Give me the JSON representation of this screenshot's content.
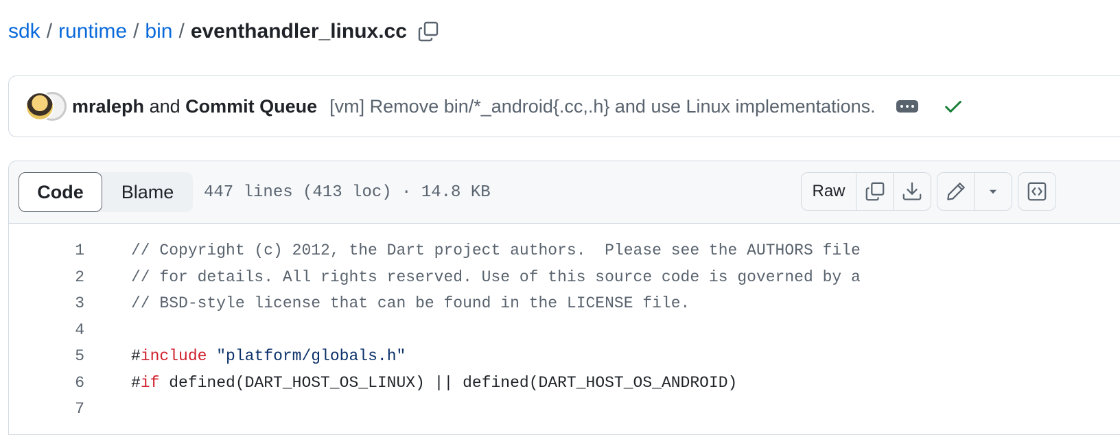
{
  "breadcrumb": {
    "parts": [
      "sdk",
      "runtime",
      "bin"
    ],
    "separator": "/",
    "file": "eventhandler_linux.cc"
  },
  "commit": {
    "author1": "mraleph",
    "and_text": "and",
    "author2": "Commit Queue",
    "message": "[vm] Remove bin/*_android{.cc,.h} and use Linux implementations.",
    "status": "success",
    "status_color": "#1a7f37"
  },
  "file_header": {
    "tabs": [
      "Code",
      "Blame"
    ],
    "active_tab": "Code",
    "meta": "447 lines (413 loc) · 14.8 KB",
    "raw_label": "Raw"
  },
  "icons": {
    "copy_path": "copy-icon",
    "copy_raw": "copy-icon",
    "download": "download-icon",
    "edit": "pencil-icon",
    "more": "triangle-down-icon",
    "symbols": "code-square-icon"
  },
  "code_lines": [
    {
      "n": "1",
      "tokens": [
        {
          "t": "// Copyright (c) 2012, the Dart project authors.  Please see the AUTHORS file",
          "c": "comment"
        }
      ]
    },
    {
      "n": "2",
      "tokens": [
        {
          "t": "// for details. All rights reserved. Use of this source code is governed by a",
          "c": "comment"
        }
      ]
    },
    {
      "n": "3",
      "tokens": [
        {
          "t": "// BSD-style license that can be found in the LICENSE file.",
          "c": "comment"
        }
      ]
    },
    {
      "n": "4",
      "tokens": []
    },
    {
      "n": "5",
      "tokens": [
        {
          "t": "#",
          "c": "plain"
        },
        {
          "t": "include",
          "c": "kw"
        },
        {
          "t": " ",
          "c": "plain"
        },
        {
          "t": "\"platform/globals.h\"",
          "c": "str"
        }
      ]
    },
    {
      "n": "6",
      "tokens": [
        {
          "t": "#",
          "c": "plain"
        },
        {
          "t": "if",
          "c": "kw"
        },
        {
          "t": " defined(DART_HOST_OS_LINUX) || defined(DART_HOST_OS_ANDROID)",
          "c": "plain"
        }
      ]
    },
    {
      "n": "7",
      "tokens": []
    }
  ]
}
